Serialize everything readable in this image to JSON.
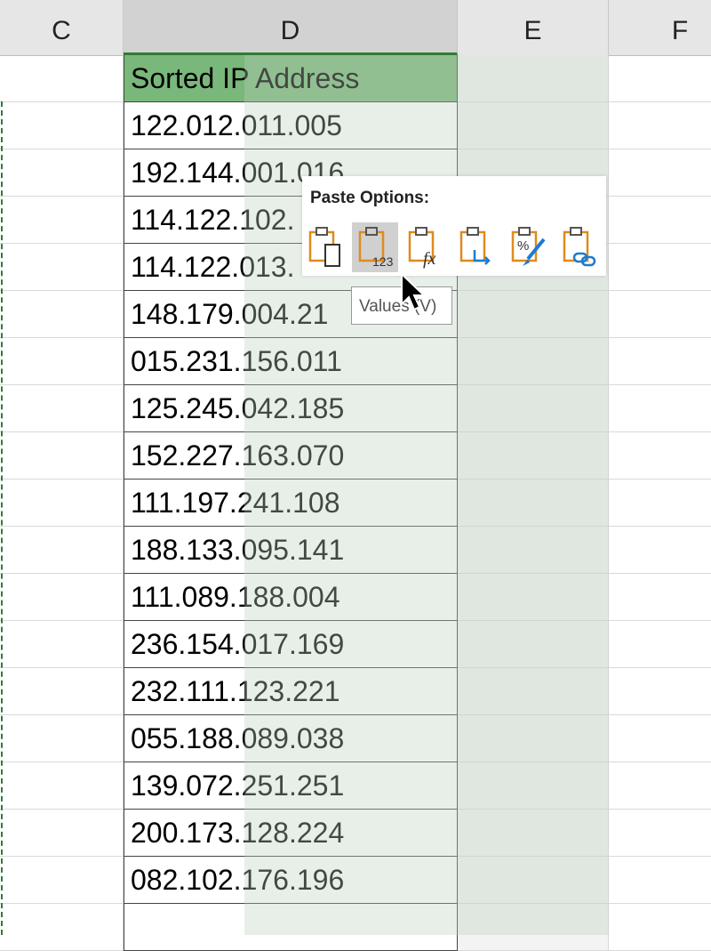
{
  "columns": {
    "c": "C",
    "d": "D",
    "e": "E",
    "f": "F"
  },
  "header_cell": "Sorted IP Address",
  "rows": [
    "122.012.011.005",
    "192.144.001.016",
    "114.122.102.",
    "114.122.013.",
    "148.179.004.21",
    "015.231.156.011",
    "125.245.042.185",
    "152.227.163.070",
    "111.197.241.108",
    "188.133.095.141",
    "111.089.188.004",
    "236.154.017.169",
    "232.111.123.221",
    "055.188.089.038",
    "139.072.251.251",
    "200.173.128.224",
    "082.102.176.196",
    ""
  ],
  "paste_menu": {
    "title": "Paste Options:",
    "buttons": [
      {
        "icon": "paste-icon"
      },
      {
        "icon": "paste-values-icon",
        "label": "123"
      },
      {
        "icon": "paste-formulas-icon",
        "label": "fx"
      },
      {
        "icon": "paste-transpose-icon"
      },
      {
        "icon": "paste-formatting-icon"
      },
      {
        "icon": "paste-link-icon"
      }
    ]
  },
  "tooltip": "Values (V)",
  "colors": {
    "header_fill": "#7ab77a",
    "icon_orange": "#e08a1e",
    "icon_blue": "#1e7bd0"
  }
}
